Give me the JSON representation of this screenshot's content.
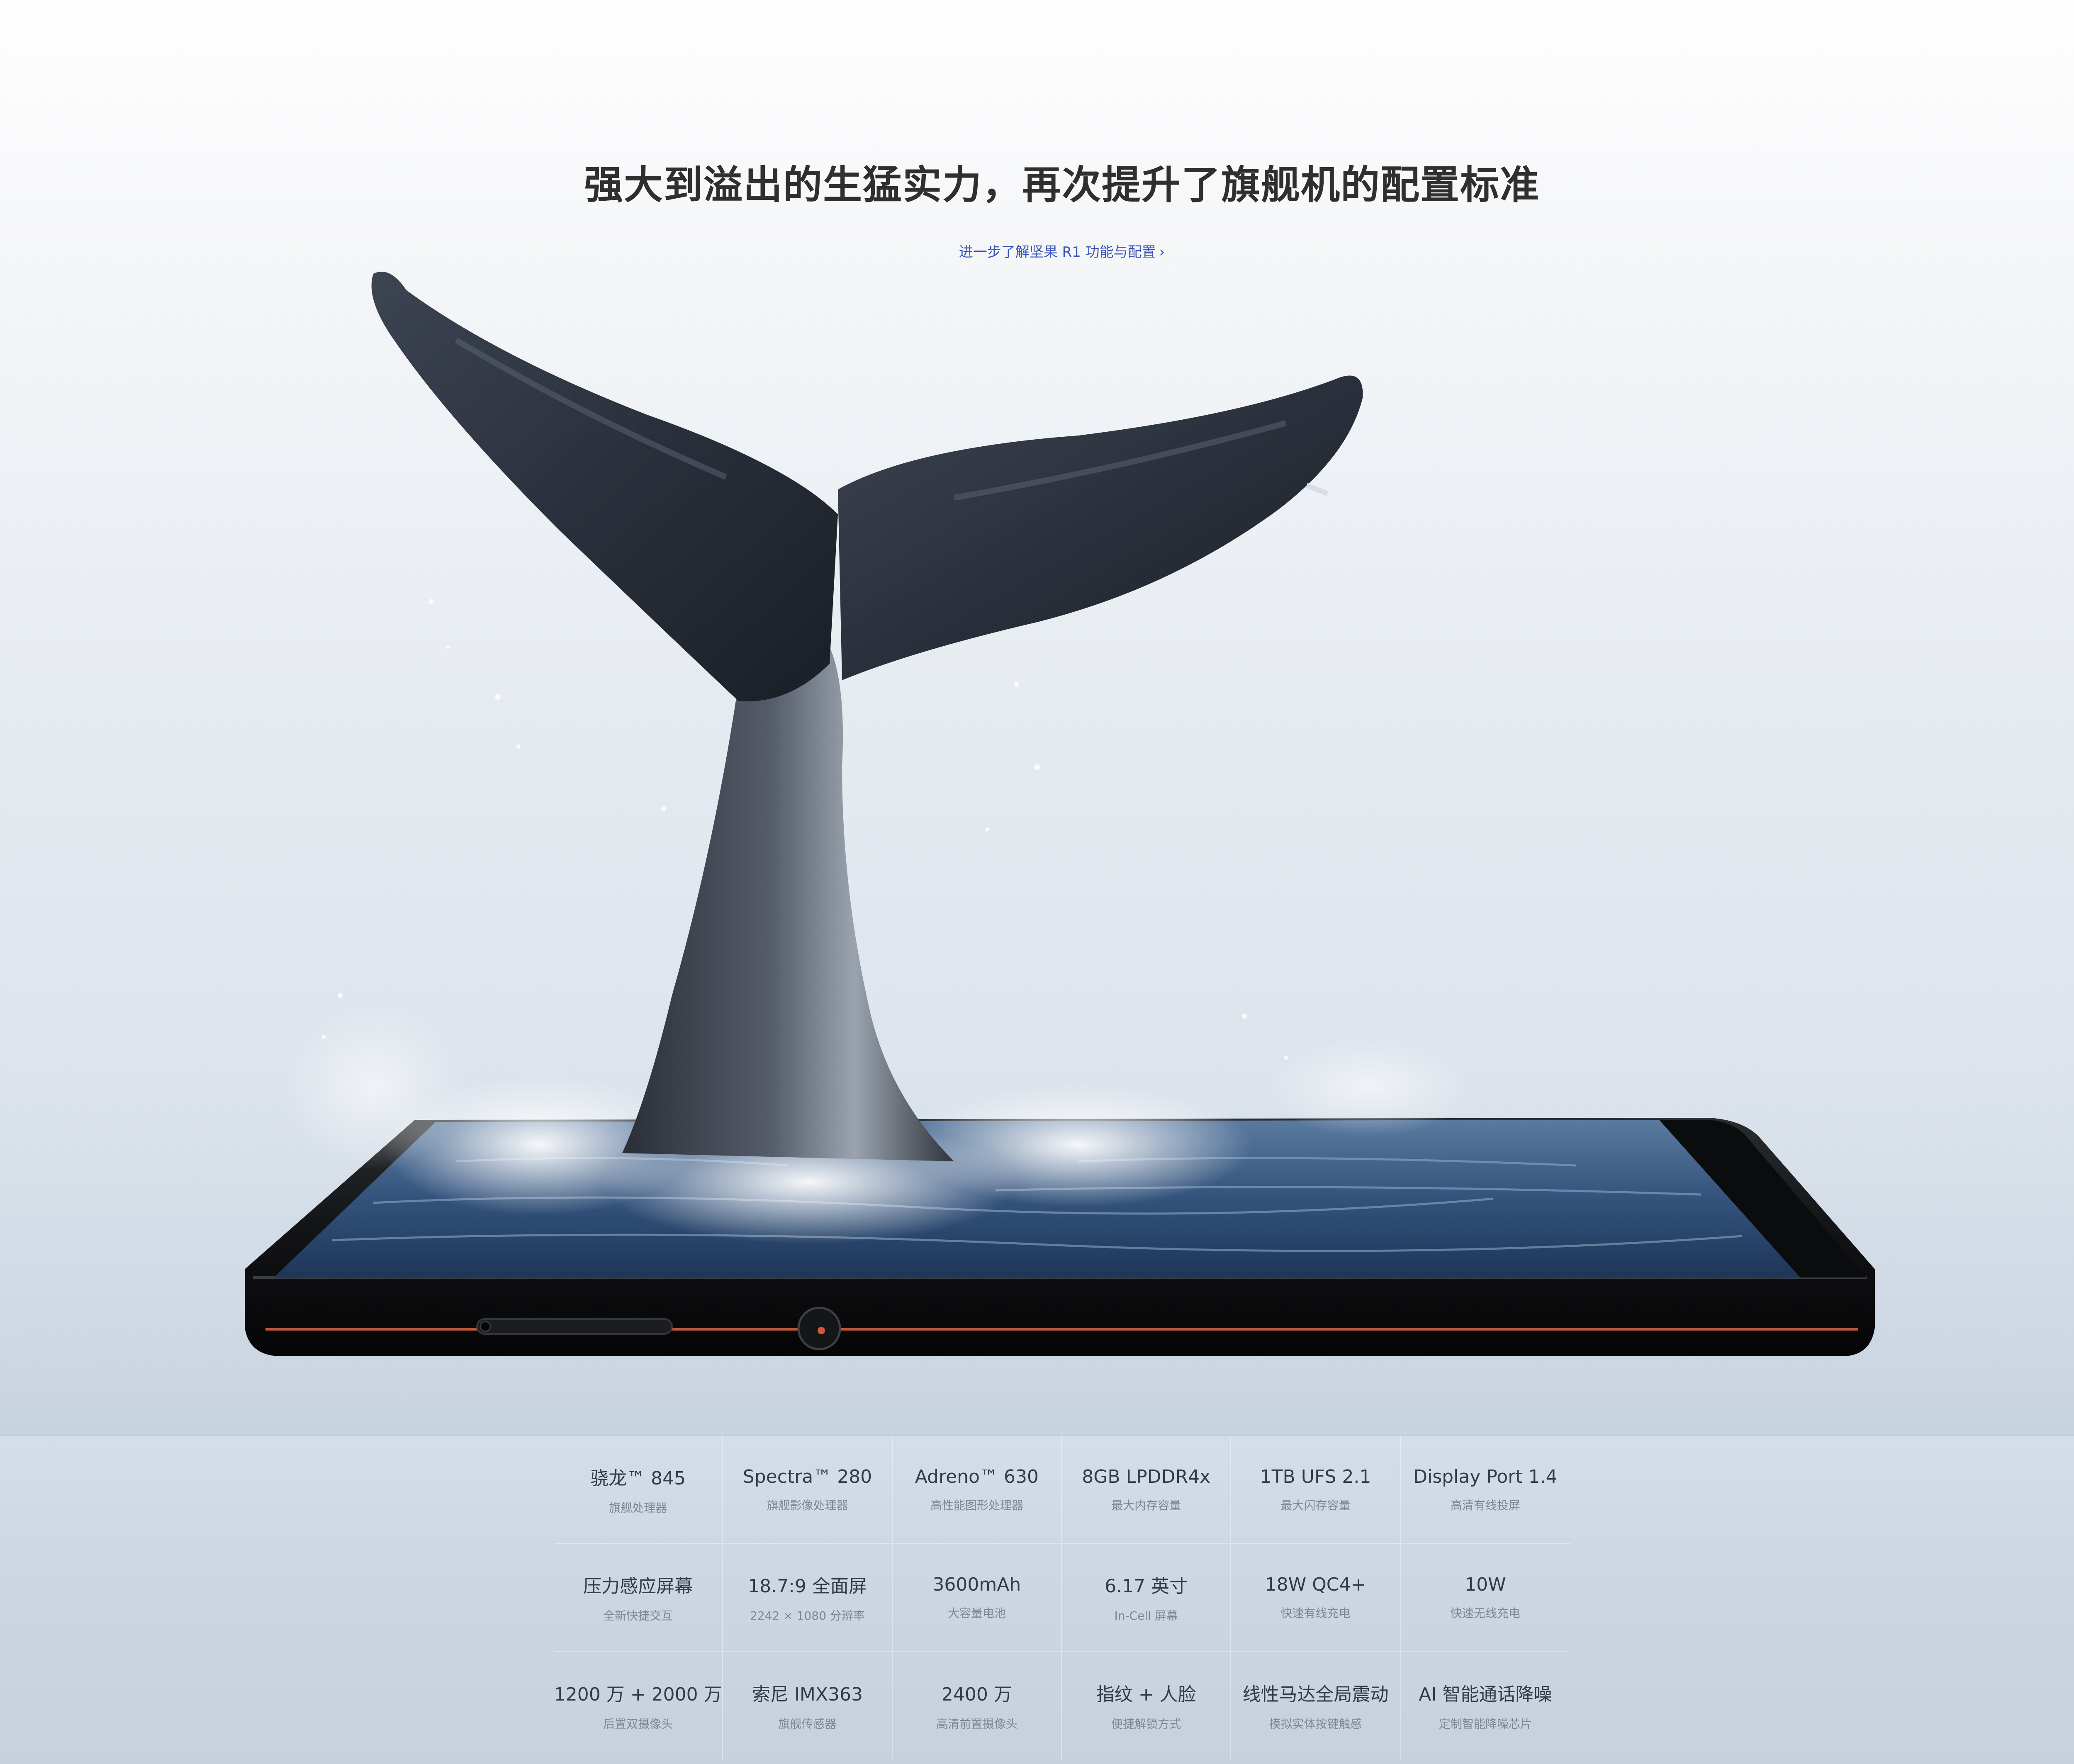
{
  "headline": "强大到溢出的生猛实力，再次提升了旗舰机的配置标准",
  "learn_more": {
    "label": "进一步了解坚果 R1 功能与配置",
    "chevron": "›"
  },
  "specs": [
    {
      "title": "骁龙™ 845",
      "subtitle": "旗舰处理器"
    },
    {
      "title": "Spectra™ 280",
      "subtitle": "旗舰影像处理器"
    },
    {
      "title": "Adreno™ 630",
      "subtitle": "高性能图形处理器"
    },
    {
      "title": "8GB LPDDR4x",
      "subtitle": "最大内存容量"
    },
    {
      "title": "1TB UFS 2.1",
      "subtitle": "最大闪存容量"
    },
    {
      "title": "Display Port 1.4",
      "subtitle": "高清有线投屏"
    },
    {
      "title": "压力感应屏幕",
      "subtitle": "全新快捷交互"
    },
    {
      "title": "18.7:9 全面屏",
      "subtitle": "2242 × 1080 分辨率"
    },
    {
      "title": "3600mAh",
      "subtitle": "大容量电池"
    },
    {
      "title": "6.17 英寸",
      "subtitle": "In-Cell 屏幕"
    },
    {
      "title": "18W QC4+",
      "subtitle": "快速有线充电"
    },
    {
      "title": "10W",
      "subtitle": "快速无线充电"
    },
    {
      "title": "1200 万 + 2000 万",
      "subtitle": "后置双摄像头"
    },
    {
      "title": "索尼 IMX363",
      "subtitle": "旗舰传感器"
    },
    {
      "title": "2400 万",
      "subtitle": "高清前置摄像头"
    },
    {
      "title": "指纹 + 人脸",
      "subtitle": "便捷解锁方式"
    },
    {
      "title": "线性马达全局震动",
      "subtitle": "模拟实体按键触感"
    },
    {
      "title": "AI 智能通话降噪",
      "subtitle": "定制智能降噪芯片"
    }
  ]
}
